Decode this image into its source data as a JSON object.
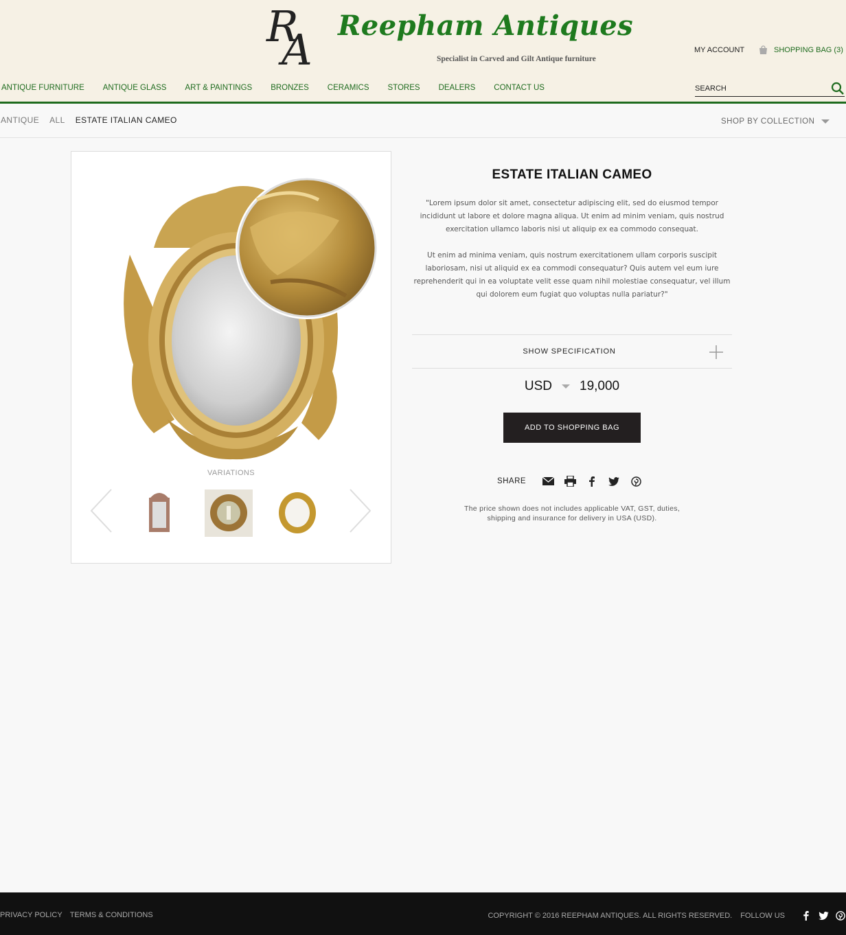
{
  "header": {
    "brand_name": "Reepham Antiques",
    "tagline": "Specialist in Carved and Gilt Antique furniture",
    "logo_monogram": "RA",
    "account_label": "MY ACCOUNT",
    "bag_label": "SHOPPING BAG (3)",
    "search_placeholder": "SEARCH",
    "brand_color": "#1e6b1e"
  },
  "nav": {
    "items": [
      {
        "label": "ANTIQUE FURNITURE"
      },
      {
        "label": "ANTIQUE GLASS"
      },
      {
        "label": "ART & PAINTINGS"
      },
      {
        "label": "BRONZES"
      },
      {
        "label": "CERAMICS"
      },
      {
        "label": "STORES"
      },
      {
        "label": "DEALERS"
      },
      {
        "label": "CONTACT US"
      }
    ]
  },
  "breadcrumb": {
    "items": [
      "ANTIQUE",
      "ALL",
      "ESTATE ITALIAN CAMEO"
    ],
    "collection_label": "SHOP BY COLLECTION"
  },
  "gallery": {
    "variations_label": "VARIATIONS",
    "thumbnails": [
      {
        "name": "rectangular-mirror-thumbnail"
      },
      {
        "name": "round-ornate-mirror-thumbnail"
      },
      {
        "name": "oval-gilt-mirror-thumbnail"
      }
    ]
  },
  "product": {
    "title": "ESTATE ITALIAN CAMEO",
    "description_1": "\"Lorem ipsum dolor sit amet, consectetur adipiscing elit, sed do eiusmod tempor incididunt ut labore et dolore magna aliqua. Ut enim ad minim veniam, quis nostrud exercitation ullamco laboris nisi ut aliquip ex ea commodo consequat.",
    "description_2": "Ut enim ad minima veniam, quis nostrum exercitationem ullam corporis suscipit laboriosam, nisi ut aliquid ex ea commodi consequatur? Quis autem vel eum iure reprehenderit qui in ea voluptate velit esse quam nihil molestiae consequatur, vel illum qui dolorem eum fugiat quo voluptas nulla pariatur?\"",
    "spec_label": "SHOW SPECIFICATION",
    "currency": "USD",
    "price": "19,000",
    "add_button": "ADD TO SHOPPING BAG",
    "share_label": "SHARE",
    "share_icons": [
      "email-icon",
      "print-icon",
      "facebook-icon",
      "twitter-icon",
      "pinterest-icon"
    ],
    "price_note_1": "The price shown does not includes applicable VAT, GST, duties,",
    "price_note_2": "shipping and insurance for delivery in USA (USD)."
  },
  "footer": {
    "privacy": "PRIVACY POLICY",
    "terms": "TERMS & CONDITIONS",
    "copyright": "COPYRIGHT © 2016 REEPHAM ANTIQUES. ALL RIGHTS RESERVED.",
    "follow": "FOLLOW US"
  }
}
